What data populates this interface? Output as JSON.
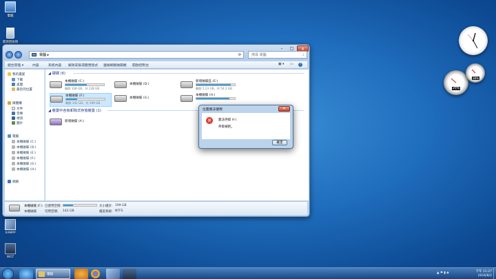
{
  "desktop": {
    "icons": [
      "電腦",
      "資源回收筒",
      "XAMPP",
      "WGT"
    ]
  },
  "window": {
    "address_path": "電腦",
    "search_placeholder": "搜尋 電腦",
    "toolbar": [
      "組合管理 ▾",
      "內容",
      "系統內容",
      "解除安裝或變更程式",
      "連線網路磁碟機",
      "開啟控制台"
    ],
    "sidebar": {
      "favorites_header": "我的最愛",
      "favorites": [
        "下載",
        "桌面",
        "最近的位置"
      ],
      "library_header": "媒體櫃",
      "libraries": [
        "文件",
        "音樂",
        "視訊",
        "圖片"
      ],
      "computer_header": "電腦",
      "drives": [
        "本機磁碟 (C:)",
        "本機磁碟 (D:)",
        "本機磁碟 (E:)",
        "本機磁碟 (F:)",
        "本機磁碟 (G:)",
        "本機磁碟 (H:)"
      ],
      "network": "網路"
    },
    "content": {
      "hdd_group": "硬碟 (6)",
      "removable_group": "裝置中含有卸除式存放裝置 (1)",
      "drives": [
        {
          "name": "本機磁碟 (C:)",
          "info": "剩餘 108 GB，共 238 GB",
          "fill": 0.55
        },
        {
          "name": "本機磁碟 (D:)",
          "info": "",
          "fill": 0
        },
        {
          "name": "新增磁碟區 (E:)",
          "info": "剩餘 5.23 GB，共 54.2 GB",
          "fill": 0.9
        },
        {
          "name": "本機磁碟 (F:)",
          "info": "剩餘 142 GB，共 199 GB",
          "fill": 0.29
        },
        {
          "name": "本機磁碟 (G:)",
          "info": "",
          "fill": 0
        },
        {
          "name": "本機磁碟 (H:)",
          "info": "",
          "fill": 0.85
        }
      ],
      "dvd": "新增磁碟 (A:)"
    },
    "details": {
      "name": "本機磁碟 (F:)",
      "type": "本機磁碟",
      "used_label": "已使用空間:",
      "free_label": "可用空間:",
      "free_value": "142 GB",
      "total_label": "大小總計:",
      "total_value": "199 GB",
      "fs_label": "檔案系統:",
      "fs_value": "NTFS",
      "used_fill": 0.29
    }
  },
  "dialog": {
    "title": "位置無法使用",
    "msg1": "無法存取 H:\\",
    "msg2": "存取被拒。",
    "ok": "確定"
  },
  "gadgets": {
    "cpu": "29%",
    "mem": "38%"
  },
  "taskbar": {
    "time": "下午 11:27",
    "date": "2016/8/2"
  }
}
